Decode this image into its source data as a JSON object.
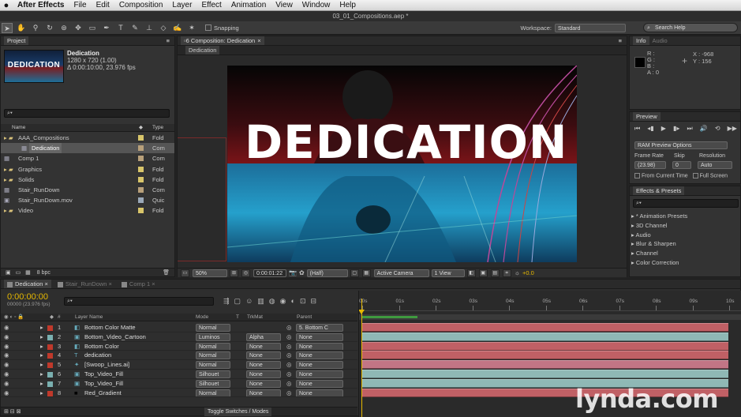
{
  "menubar": {
    "app": "After Effects",
    "items": [
      "File",
      "Edit",
      "Composition",
      "Layer",
      "Effect",
      "Animation",
      "View",
      "Window",
      "Help"
    ]
  },
  "window_title": "03_01_Compositions.aep *",
  "toolbar": {
    "snapping_label": "Snapping",
    "workspace_label": "Workspace:",
    "workspace_value": "Standard",
    "search_placeholder": "Search Help"
  },
  "project": {
    "tab": "Project",
    "comp_name": "Dedication",
    "comp_size": "1280 x 720 (1.00)",
    "comp_duration": "Δ 0:00:10:00, 23.976 fps",
    "thumb_text": "DEDICATION",
    "col_name": "Name",
    "col_type": "Type",
    "bpc": "8 bpc",
    "items": [
      {
        "name": "AAA_Compositions",
        "type": "Fold",
        "color": "#d8c56a",
        "kind": "folder",
        "indent": 0,
        "selected": false
      },
      {
        "name": "Dedication",
        "type": "Com",
        "color": "#b8a07a",
        "kind": "comp",
        "indent": 1,
        "selected": true
      },
      {
        "name": "Comp 1",
        "type": "Com",
        "color": "#b8a07a",
        "kind": "comp",
        "indent": 0,
        "selected": false
      },
      {
        "name": "Graphics",
        "type": "Fold",
        "color": "#d8c56a",
        "kind": "folder",
        "indent": 0,
        "selected": false
      },
      {
        "name": "Solids",
        "type": "Fold",
        "color": "#d8c56a",
        "kind": "folder",
        "indent": 0,
        "selected": false
      },
      {
        "name": "Stair_RunDown",
        "type": "Com",
        "color": "#b8a07a",
        "kind": "comp",
        "indent": 0,
        "selected": false
      },
      {
        "name": "Stair_RunDown.mov",
        "type": "Quic",
        "color": "#9aa8b8",
        "kind": "movie",
        "indent": 0,
        "selected": false
      },
      {
        "name": "Video",
        "type": "Fold",
        "color": "#d8c56a",
        "kind": "folder",
        "indent": 0,
        "selected": false
      }
    ]
  },
  "composition": {
    "tab": "Composition: Dedication",
    "subtab": "Dedication",
    "frame_text": "DEDICATION",
    "zoom": "50%",
    "timecode": "0:00:01:22",
    "resolution": "(Half)",
    "camera": "Active Camera",
    "views": "1 View",
    "exposure": "+0.0"
  },
  "info": {
    "tab": "Info",
    "tab2": "Audio",
    "r": "R :",
    "g": "G :",
    "b": "B :",
    "a": "A : 0",
    "x": "X : -968",
    "y": "Y : 156"
  },
  "preview": {
    "tab": "Preview",
    "ram_options": "RAM Preview Options",
    "frame_rate_label": "Frame Rate",
    "skip_label": "Skip",
    "resolution_label": "Resolution",
    "frame_rate": "(23.98)",
    "skip": "0",
    "resolution": "Auto",
    "from_current": "From Current Time",
    "full_screen": "Full Screen"
  },
  "effects": {
    "tab": "Effects & Presets",
    "items": [
      "* Animation Presets",
      "3D Channel",
      "Audio",
      "Blur & Sharpen",
      "Channel",
      "Color Correction"
    ]
  },
  "timeline": {
    "tabs": [
      "Dedication",
      "Stair_RunDown",
      "Comp 1"
    ],
    "timecode": "0:00:00:00",
    "frames": "00000 (23.976 fps)",
    "col_layer": "Layer Name",
    "col_mode": "Mode",
    "col_t": "T",
    "col_trkmat": "TrkMat",
    "col_parent": "Parent",
    "ruler": [
      "00s",
      "01s",
      "02s",
      "03s",
      "04s",
      "05s",
      "06s",
      "07s",
      "08s",
      "09s",
      "10s"
    ],
    "toggle": "Toggle Switches / Modes",
    "layers": [
      {
        "num": "1",
        "name": "Bottom Color Matte",
        "mode": "Normal",
        "trkmat": "",
        "parent": "5. Bottom C",
        "label": "#c0392b",
        "bar": "#c06065",
        "icon": "solid"
      },
      {
        "num": "2",
        "name": "Bottom_Video_Cartoon",
        "mode": "Luminos",
        "trkmat": "Alpha",
        "parent": "None",
        "label": "#7ab0b0",
        "bar": "#8fb8b5",
        "icon": "video"
      },
      {
        "num": "3",
        "name": "Bottom Color",
        "mode": "Normal",
        "trkmat": "None",
        "parent": "None",
        "label": "#c0392b",
        "bar": "#c06065",
        "icon": "solid"
      },
      {
        "num": "4",
        "name": "dedication",
        "mode": "Normal",
        "trkmat": "None",
        "parent": "None",
        "label": "#c0392b",
        "bar": "#c06065",
        "icon": "text"
      },
      {
        "num": "5",
        "name": "[Swoop_Lines.ai]",
        "mode": "Normal",
        "trkmat": "None",
        "parent": "None",
        "label": "#c0392b",
        "bar": "#c27585",
        "icon": "ai"
      },
      {
        "num": "6",
        "name": "Top_Video_Fill",
        "mode": "Silhouet",
        "trkmat": "None",
        "parent": "None",
        "label": "#7ab0b0",
        "bar": "#8fb8b5",
        "icon": "video"
      },
      {
        "num": "7",
        "name": "Top_Video_Fill",
        "mode": "Silhouet",
        "trkmat": "None",
        "parent": "None",
        "label": "#7ab0b0",
        "bar": "#8fb8b5",
        "icon": "video"
      },
      {
        "num": "8",
        "name": "Red_Gradient",
        "mode": "Normal",
        "trkmat": "None",
        "parent": "None",
        "label": "#c0392b",
        "bar": "#c06065",
        "icon": "black"
      }
    ]
  },
  "watermark": "lynda.com"
}
